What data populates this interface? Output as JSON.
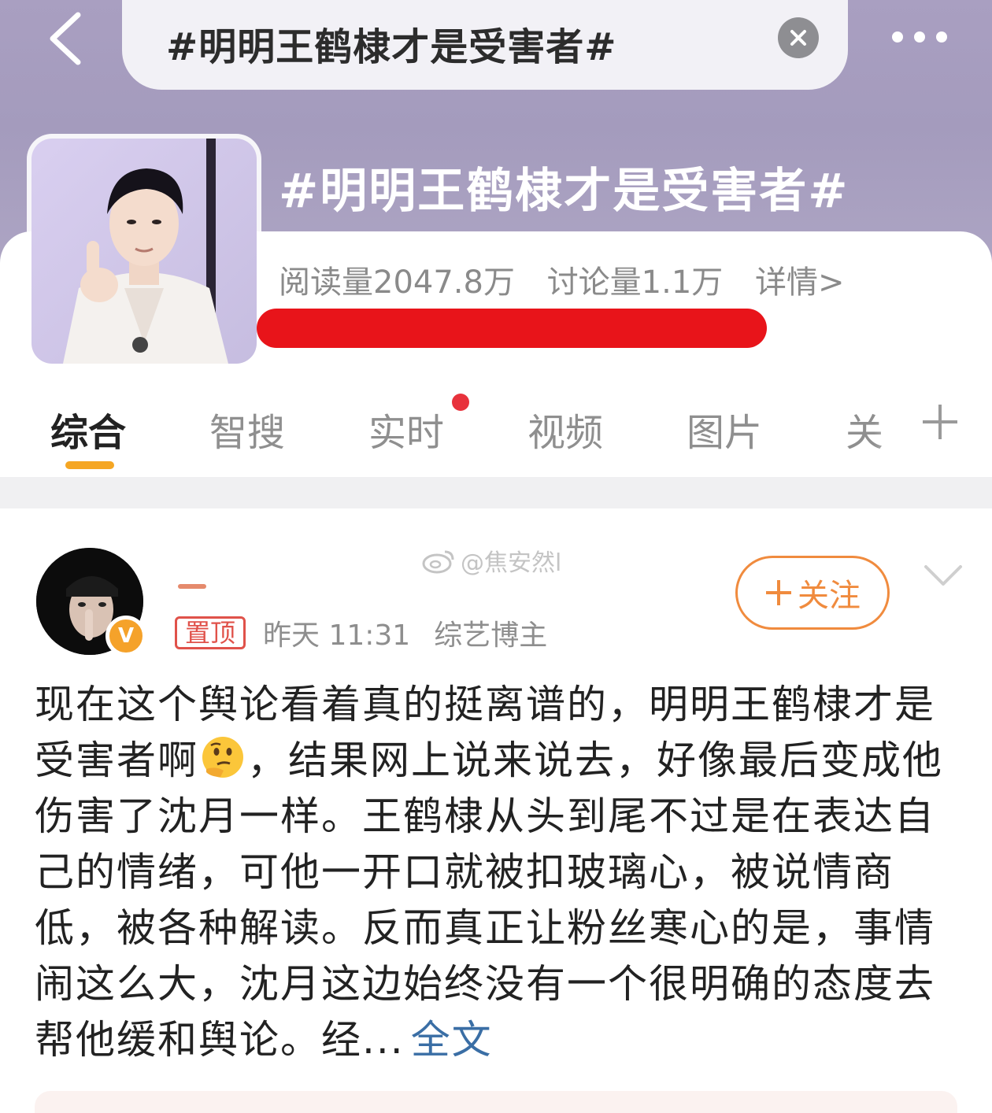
{
  "search": {
    "query": "#明明王鹤棣才是受害者#"
  },
  "topic": {
    "title": "#明明王鹤棣才是受害者#",
    "reads": "阅读量2047.8万",
    "discussions": "讨论量1.1万",
    "details_link": "详情>"
  },
  "tabs": [
    {
      "label": "综合",
      "active": true
    },
    {
      "label": "智搜",
      "active": false
    },
    {
      "label": "实时",
      "active": false,
      "has_dot": true
    },
    {
      "label": "视频",
      "active": false
    },
    {
      "label": "图片",
      "active": false
    },
    {
      "label": "关",
      "active": false
    }
  ],
  "post": {
    "watermark": "@焦安然l",
    "follow_label": "关注",
    "pin_label": "置顶",
    "time": "昨天 11:31",
    "role": "综艺博主",
    "text_before_emoji": "现在这个舆论看着真的挺离谱的，明明王鹤棣才是受害者啊",
    "text_after_emoji": "，结果网上说来说去，好像最后变成他伤害了沈月一样。王鹤棣从头到尾不过是在表达自己的情绪，可他一开口就被扣玻璃心，被说情商低，被各种解读。反而真正让粉丝寒心的是，事情闹这么大，沈月这边始终没有一个很明确的态度去帮他缓和舆论。经...",
    "full_text_link": "全文",
    "emoji": "thinking-face-emoji"
  },
  "colors": {
    "header_bg": "#a99fc1",
    "accent_orange": "#f08b3e",
    "tab_underline": "#f5a623",
    "redaction": "#e8141a",
    "link_blue": "#3a6ea5"
  }
}
